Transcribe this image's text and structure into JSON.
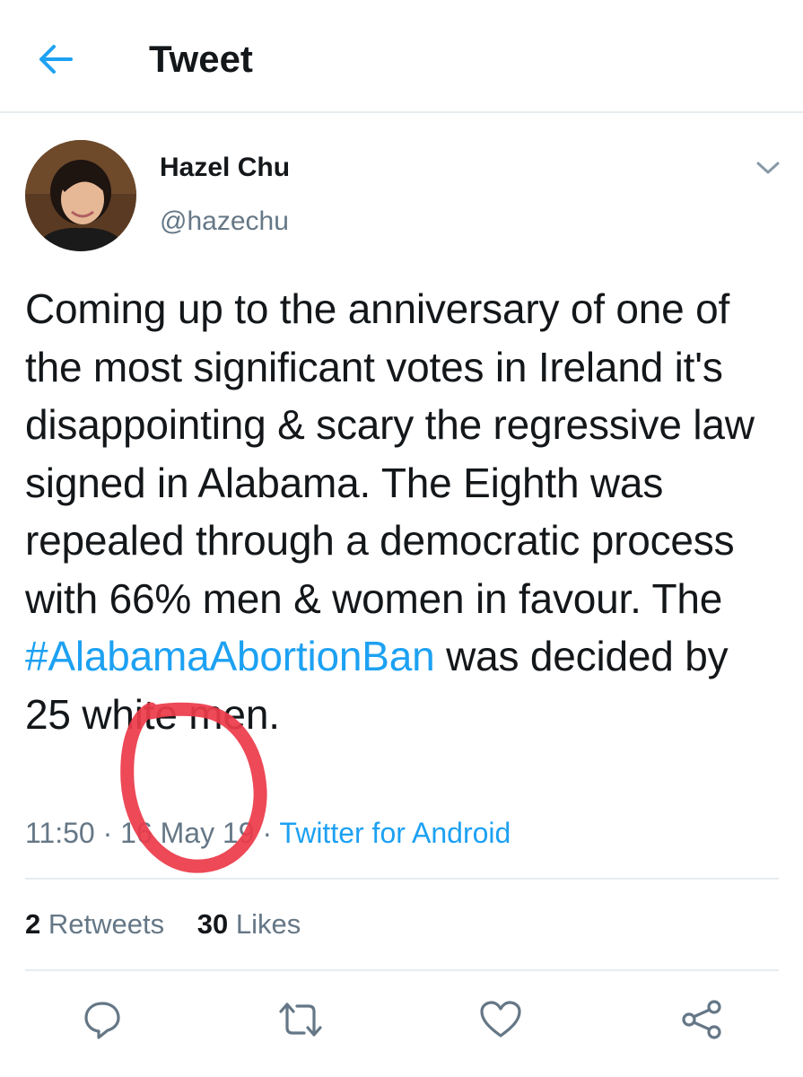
{
  "header": {
    "title": "Tweet",
    "back_icon": "arrow-left-icon",
    "accent": "#1da1f2"
  },
  "user": {
    "display_name": "Hazel Chu",
    "handle": "@hazechu"
  },
  "tweet": {
    "text_lines_before_hashtag": "Coming up to the anniversary of one of the most significant votes in Ireland it's disappointing & scary the regressive law signed in Alabama. The Eighth was repealed through a democratic process with 66% men & women in favour. The",
    "hashtag": "#AlabamaAbortionBan",
    "text_after_hashtag": " was decided by 25 white men.",
    "time": "11:50",
    "date": "16 May 19",
    "source": "Twitter for Android"
  },
  "stats": {
    "retweets_count": "2",
    "retweets_label": "Retweets",
    "likes_count": "30",
    "likes_label": "Likes"
  },
  "actions": [
    "reply-icon",
    "retweet-icon",
    "like-icon",
    "share-icon"
  ],
  "annotation_color": "#ec3b4a"
}
